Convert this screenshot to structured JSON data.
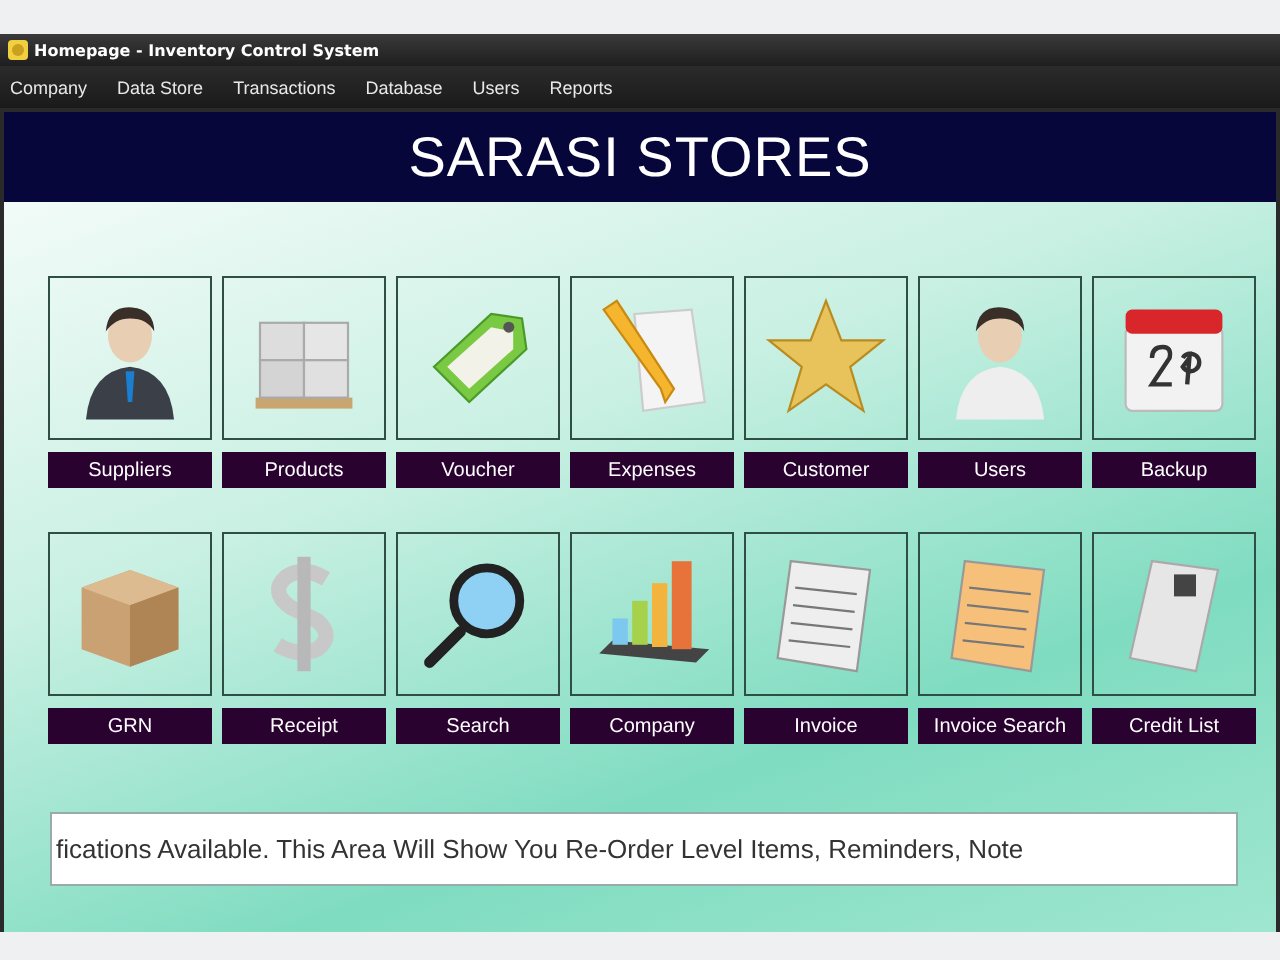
{
  "window": {
    "title": "Homepage - Inventory Control System"
  },
  "menu": [
    "Company",
    "Data Store",
    "Transactions",
    "Database",
    "Users",
    "Reports"
  ],
  "banner": {
    "title": "SARASI STORES"
  },
  "tile_rows": [
    [
      {
        "label": "Suppliers",
        "kind": "businessman"
      },
      {
        "label": "Products",
        "kind": "pallet"
      },
      {
        "label": "Voucher",
        "kind": "tag"
      },
      {
        "label": "Expenses",
        "kind": "pencil"
      },
      {
        "label": "Customer",
        "kind": "star"
      },
      {
        "label": "Users",
        "kind": "user"
      },
      {
        "label": "Backup",
        "kind": "calendar"
      }
    ],
    [
      {
        "label": "GRN",
        "kind": "box"
      },
      {
        "label": "Receipt",
        "kind": "dollar"
      },
      {
        "label": "Search",
        "kind": "magnifier"
      },
      {
        "label": "Company",
        "kind": "chart"
      },
      {
        "label": "Invoice",
        "kind": "invoice"
      },
      {
        "label": "Invoice Search",
        "kind": "invoice-orange"
      },
      {
        "label": "Credit List",
        "kind": "receipt"
      }
    ]
  ],
  "notification": "fications Available. This Area Will Show You Re-Order Level Items, Reminders, Note"
}
